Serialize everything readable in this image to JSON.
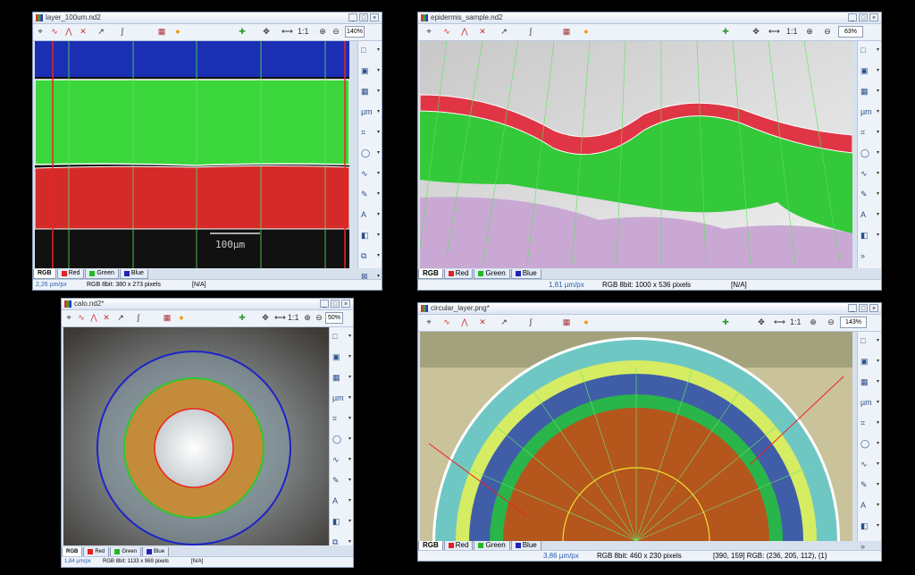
{
  "toolbar_icons": [
    "pointer-icon",
    "draw-icon",
    "draw-alt-icon",
    "eraser-icon",
    "export-icon",
    "curve-icon",
    "color-grid-icon",
    "lut-icon",
    "add-channel-icon",
    "fit-icon",
    "ruler-icon",
    "plus-icon",
    "minus-icon"
  ],
  "zoom_ratio": "1:1",
  "channel_tabs": [
    "RGB",
    "Red",
    "Green",
    "Blue"
  ],
  "channel_colors": {
    "Red": "#d22",
    "Green": "#2b2",
    "Blue": "#22b"
  },
  "windows": [
    {
      "title": "layer_100um.nd2",
      "zoom": "140%",
      "resolution": "2,26 µm/px",
      "info": "RGB 8bit: 380 x 273 pixels",
      "status": "[N/A]",
      "coords": "",
      "scalebar": "100µm"
    },
    {
      "title": "epidermis_sample.nd2",
      "zoom": "63%",
      "resolution": "1,81 µm/px",
      "info": "RGB 8bit: 1000 x 536 pixels",
      "status": "[N/A]",
      "coords": ""
    },
    {
      "title": "calo.nd2*",
      "zoom": "50%",
      "resolution": "1,84 µm/px",
      "info": "RGB 8bit: 1133 x 969 pixels",
      "status": "[N/A]",
      "coords": ""
    },
    {
      "title": "circular_layer.png*",
      "zoom": "143%",
      "resolution": "3,86 µm/px",
      "info": "RGB 8bit: 460 x 230 pixels",
      "status": "",
      "coords": "[390, 159] RGB: (236, 205, 112), {1}"
    }
  ]
}
